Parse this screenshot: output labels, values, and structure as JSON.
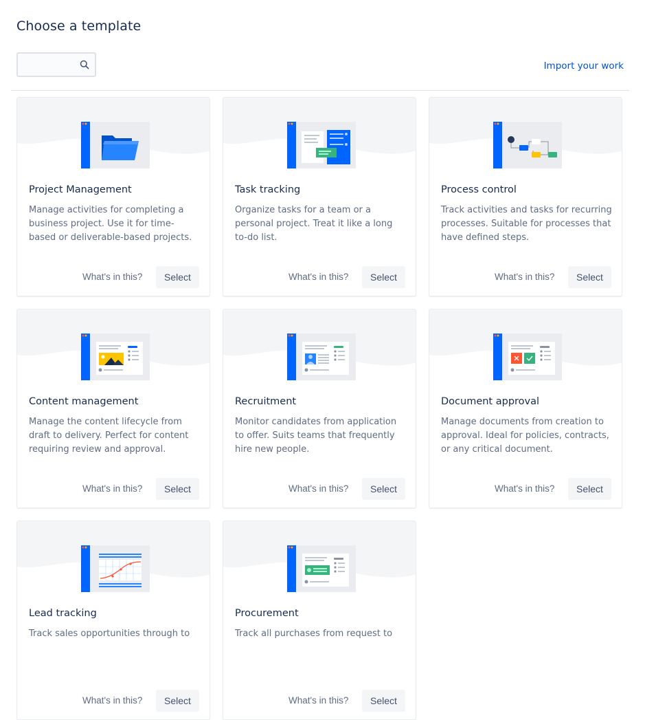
{
  "page": {
    "title": "Choose a template"
  },
  "search": {
    "placeholder": "",
    "value": ""
  },
  "header": {
    "import_label": "Import your work"
  },
  "cards": [
    {
      "title": "Project Management",
      "description": "Manage activities for completing a business project. Use it for time-based or deliverable-based projects.",
      "whats_label": "What's in this?",
      "select_label": "Select",
      "illustration": "folder-icon"
    },
    {
      "title": "Task tracking",
      "description": "Organize tasks for a team or a personal project. Treat it like a long to-do list.",
      "whats_label": "What's in this?",
      "select_label": "Select",
      "illustration": "task-board-icon"
    },
    {
      "title": "Process control",
      "description": "Track activities and tasks for recurring processes. Suitable for processes that have defined steps.",
      "whats_label": "What's in this?",
      "select_label": "Select",
      "illustration": "process-flow-icon"
    },
    {
      "title": "Content management",
      "description": "Manage the content lifecycle from draft to delivery. Perfect for content requiring review and approval.",
      "whats_label": "What's in this?",
      "select_label": "Select",
      "illustration": "image-content-icon"
    },
    {
      "title": "Recruitment",
      "description": "Monitor candidates from application to offer. Suits teams that frequently hire new people.",
      "whats_label": "What's in this?",
      "select_label": "Select",
      "illustration": "candidate-profile-icon"
    },
    {
      "title": "Document approval",
      "description": "Manage documents from creation to approval. Ideal for policies, contracts, or any critical document.",
      "whats_label": "What's in this?",
      "select_label": "Select",
      "illustration": "approve-reject-icon"
    },
    {
      "title": "Lead tracking",
      "description": "Track sales opportunities through to",
      "whats_label": "What's in this?",
      "select_label": "Select",
      "illustration": "sales-chart-icon"
    },
    {
      "title": "Procurement",
      "description": "Track all purchases from request to",
      "whats_label": "What's in this?",
      "select_label": "Select",
      "illustration": "money-icon"
    }
  ],
  "colors": {
    "accent": "#0065ff",
    "link": "#0052cc",
    "text": "#172b4d",
    "muted": "#5e6c84"
  }
}
